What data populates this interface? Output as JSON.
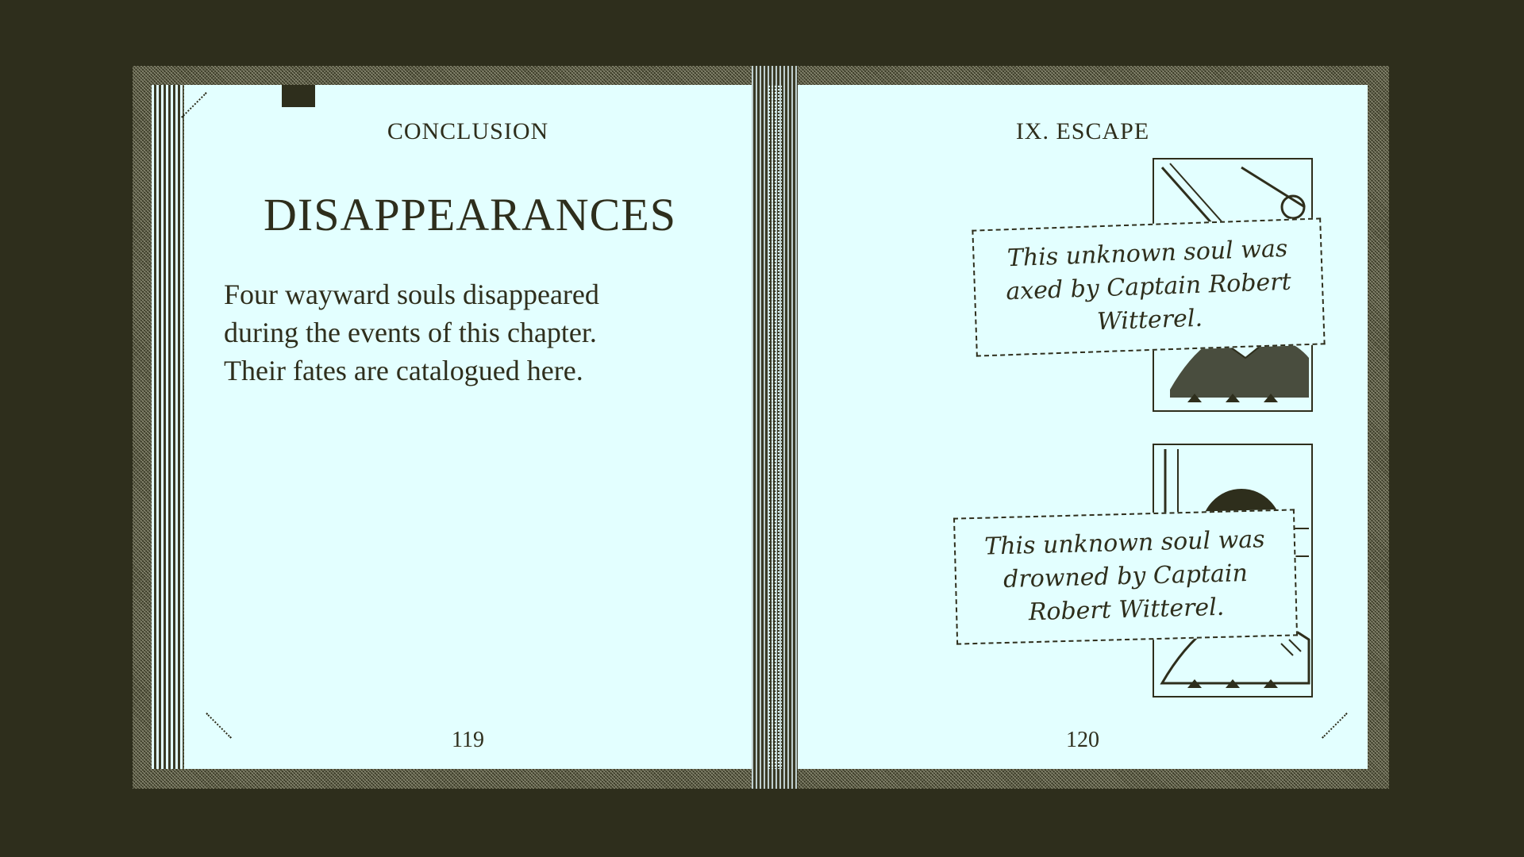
{
  "left_page": {
    "running_head": "CONCLUSION",
    "title": "DISAPPEARANCES",
    "body": [
      "Four wayward souls disappeared",
      "during the events of this chapter.",
      "Their fates are catalogued here."
    ],
    "page_number": "119"
  },
  "right_page": {
    "running_head": "IX. ESCAPE",
    "page_number": "120",
    "entries": [
      {
        "caption": [
          "This unknown soul was",
          "axed by Captain Robert",
          "Witterel."
        ]
      },
      {
        "caption": [
          "This unknown soul was",
          "drowned by Captain",
          "Robert Witterel."
        ]
      }
    ]
  },
  "colors": {
    "background": "#2e2e1c",
    "page": "#e3ffff",
    "ink": "#2e2e1c"
  }
}
